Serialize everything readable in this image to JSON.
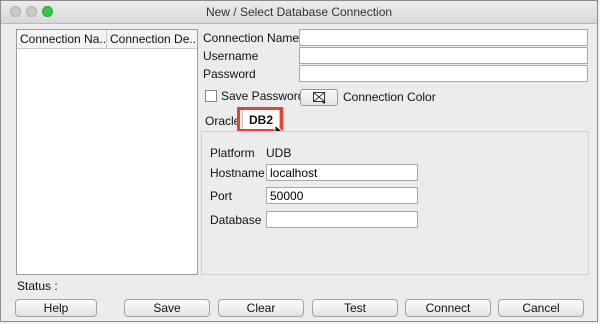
{
  "window": {
    "title": "New / Select Database Connection"
  },
  "list": {
    "col1": "Connection Na...",
    "col2": "Connection De..."
  },
  "form": {
    "conn_name_label": "Connection Name",
    "username_label": "Username",
    "password_label": "Password",
    "save_password_label": "Save Password",
    "conn_color_label": "Connection Color"
  },
  "tabs": {
    "oracle": "Oracle",
    "db2": "DB2"
  },
  "db2": {
    "platform_label": "Platform",
    "platform_value": "UDB",
    "hostname_label": "Hostname",
    "hostname_value": "localhost",
    "port_label": "Port",
    "port_value": "50000",
    "database_label": "Database",
    "database_value": ""
  },
  "status": {
    "label": "Status :"
  },
  "buttons": {
    "help": "Help",
    "save": "Save",
    "clear": "Clear",
    "test": "Test",
    "connect": "Connect",
    "cancel": "Cancel"
  }
}
